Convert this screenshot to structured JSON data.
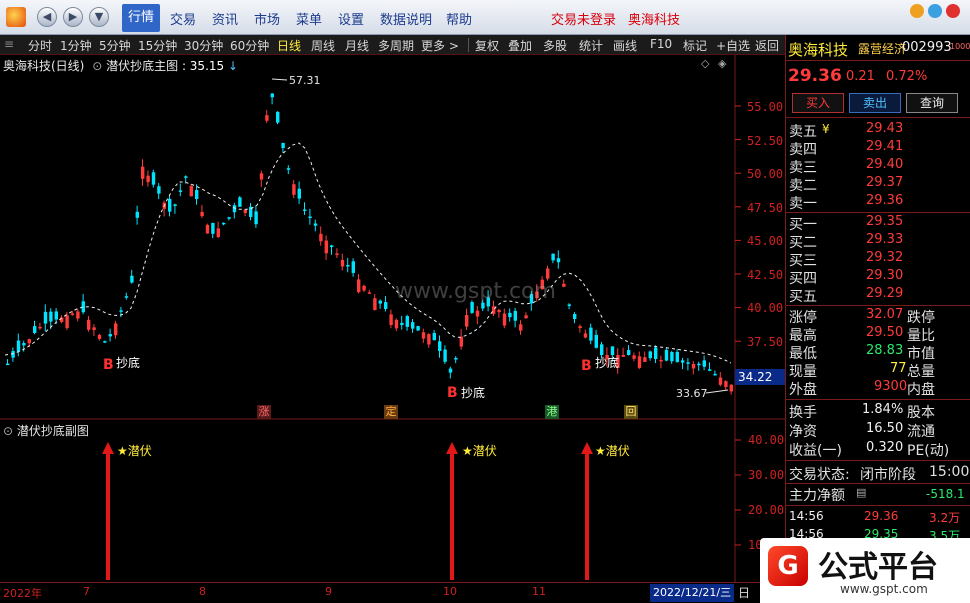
{
  "menu": {
    "items": [
      "行情",
      "交易",
      "资讯",
      "市场",
      "菜单",
      "设置",
      "数据说明",
      "帮助"
    ],
    "trade_status": "交易未登录",
    "stock": "奥海科技"
  },
  "toolbar": {
    "periods": [
      "分时",
      "1分钟",
      "5分钟",
      "15分钟",
      "30分钟",
      "60分钟",
      "日线",
      "周线",
      "月线",
      "多周期",
      "更多 >"
    ],
    "tools": [
      "复权",
      "叠加",
      "多股",
      "统计",
      "画线",
      "F10",
      "标记",
      "+自选",
      "返回"
    ]
  },
  "main_chart": {
    "title": "奥海科技(日线)",
    "indicator": "潜伏抄底主图",
    "indicator_value": ": 35.15",
    "y_ticks": [
      "55.00",
      "52.50",
      "50.00",
      "47.50",
      "45.00",
      "42.50",
      "40.00",
      "37.50",
      "35.00"
    ],
    "current_price": "34.22",
    "high_label": "57.31",
    "low_label": "33.67",
    "signal_text": "抄底",
    "signal_letter": "B",
    "watermark": "www.gspt.com",
    "events": [
      "涨",
      "定",
      "港",
      "回"
    ]
  },
  "sub_chart": {
    "title": "潜伏抄底副图",
    "y_ticks": [
      "40.00",
      "30.00",
      "20.00",
      "10"
    ],
    "signal_text": "★潜伏"
  },
  "x_axis": {
    "labels": [
      "2022年",
      "7",
      "8",
      "9",
      "10",
      "11"
    ],
    "cursor_date": "2022/12/21/三",
    "right_label": "日"
  },
  "quote": {
    "name": "奥海科技",
    "tag": "露营经济",
    "code": "002993",
    "code_suffix": "1000",
    "price": "29.36",
    "change": "0.21",
    "change_pct": "0.72%",
    "buttons": [
      "买入",
      "卖出",
      "查询"
    ],
    "asks": [
      {
        "label": "卖五",
        "price": "29.43"
      },
      {
        "label": "卖四",
        "price": "29.41"
      },
      {
        "label": "卖三",
        "price": "29.40"
      },
      {
        "label": "卖二",
        "price": "29.37"
      },
      {
        "label": "卖一",
        "price": "29.36"
      }
    ],
    "ask_currency": "¥",
    "bids": [
      {
        "label": "买一",
        "price": "29.35"
      },
      {
        "label": "买二",
        "price": "29.33"
      },
      {
        "label": "买三",
        "price": "29.32"
      },
      {
        "label": "买四",
        "price": "29.30"
      },
      {
        "label": "买五",
        "price": "29.29"
      }
    ],
    "stats": [
      {
        "label": "涨停",
        "value": "32.07",
        "right": "跌停"
      },
      {
        "label": "最高",
        "value": "29.50",
        "right": "量比"
      },
      {
        "label": "最低",
        "value": "28.83",
        "right": "市值"
      },
      {
        "label": "现量",
        "value": "77",
        "right": "总量"
      },
      {
        "label": "外盘",
        "value": "9300",
        "right": "内盘"
      }
    ],
    "fundamentals": [
      {
        "label": "换手",
        "value": "1.84%",
        "right": "股本"
      },
      {
        "label": "净资",
        "value": "16.50",
        "right": "流通"
      },
      {
        "label": "收益(一)",
        "value": "0.320",
        "right": "PE(动)"
      }
    ],
    "trade_state_label": "交易状态:",
    "trade_state": "闭市阶段",
    "trade_time": "15:00",
    "main_flow_label": "主力净额",
    "main_flow": "-518.1",
    "ticks": [
      {
        "time": "14:56",
        "price": "29.36",
        "vol": "3.2万"
      },
      {
        "time": "14:56",
        "price": "29.35",
        "vol": "3.5万"
      }
    ]
  },
  "logo": {
    "text": "公式平台",
    "url": "www.gspt.com"
  },
  "colors": {
    "up": "#ff3b3b",
    "down": "#00e5ff",
    "grid_red": "#7a1a1a",
    "menu_active": "#2f66c8"
  }
}
